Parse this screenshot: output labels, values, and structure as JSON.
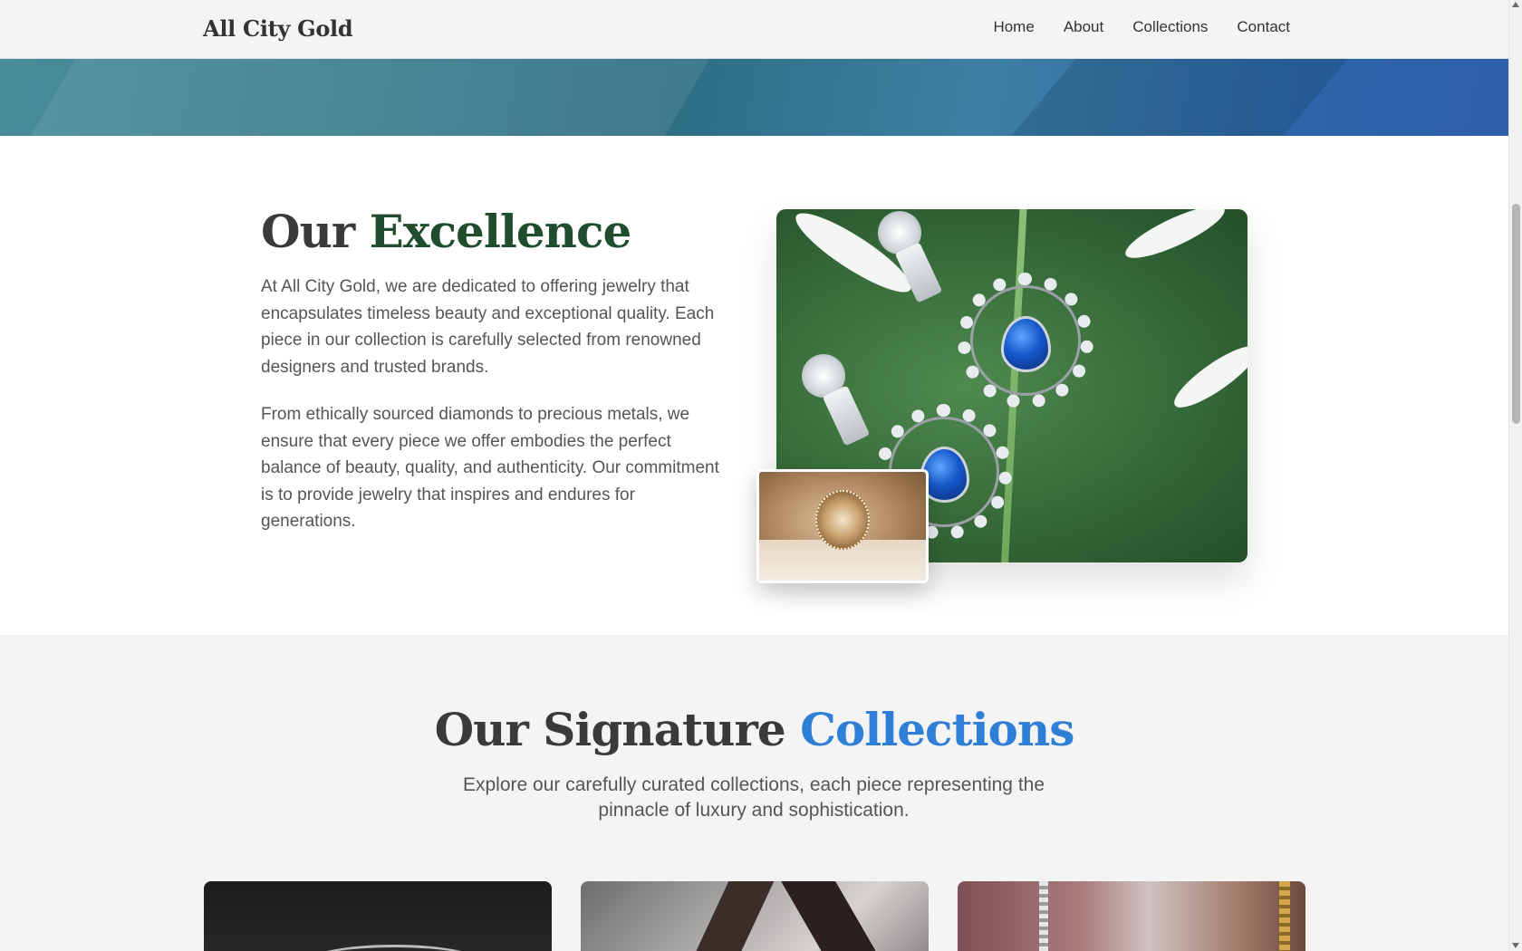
{
  "header": {
    "brand": "All City Gold",
    "nav": [
      "Home",
      "About",
      "Collections",
      "Contact"
    ]
  },
  "excellence": {
    "title_part1": "Our",
    "title_accent": "Excellence",
    "paragraph1": "At All City Gold, we are dedicated to offering jewelry that encapsulates timeless beauty and exceptional quality. Each piece in our collection is carefully selected from renowned designers and trusted brands.",
    "paragraph2": "From ethically sourced diamonds to precious metals, we ensure that every piece we offer embodies the perfect balance of beauty, quality, and authenticity. Our commitment is to provide jewelry that inspires and endures for generations."
  },
  "collections": {
    "title_part1": "Our Signature",
    "title_accent": "Collections",
    "subtitle": "Explore our carefully curated collections, each piece representing the pinnacle of luxury and sophistication."
  },
  "colors": {
    "excellence_accent": "#1f4d2e",
    "collections_accent": "#2f7fd6"
  }
}
